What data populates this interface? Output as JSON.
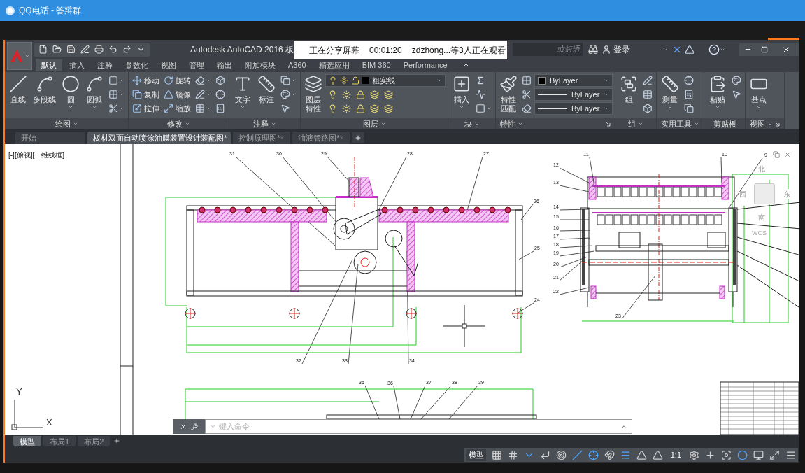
{
  "qq_window": {
    "title": "QQ电话 - 答辩群"
  },
  "share_banner": {
    "status": "正在分享屏幕",
    "timer": "00:01:20",
    "viewers": "zdzhong...等3人正在观看"
  },
  "titlebar": {
    "title": "Autodesk AutoCAD 2016",
    "title_cut": "板",
    "search_placeholder": "或短语",
    "login": "登录"
  },
  "ribbon_tabs": [
    {
      "label": "默认",
      "selected": true
    },
    {
      "label": "插入",
      "selected": false
    },
    {
      "label": "注释",
      "selected": false
    },
    {
      "label": "参数化",
      "selected": false
    },
    {
      "label": "视图",
      "selected": false
    },
    {
      "label": "管理",
      "selected": false
    },
    {
      "label": "输出",
      "selected": false
    },
    {
      "label": "附加模块",
      "selected": false
    },
    {
      "label": "A360",
      "selected": false
    },
    {
      "label": "精选应用",
      "selected": false
    },
    {
      "label": "BIM 360",
      "selected": false
    },
    {
      "label": "Performance",
      "selected": false
    }
  ],
  "ribbon_panels": [
    {
      "label": "绘图",
      "menu": true,
      "launcher": false,
      "columns": [
        [
          {
            "kind": "large",
            "label": "直线"
          }
        ],
        [
          {
            "kind": "large",
            "label": "多段线"
          }
        ],
        [
          {
            "kind": "large_menu",
            "label": "圆"
          }
        ],
        [
          {
            "kind": "large_menu",
            "label": "圆弧"
          }
        ],
        [
          {
            "kind": "icon_menu"
          },
          {
            "kind": "icon_menu"
          },
          {
            "kind": "icon_menu"
          }
        ]
      ]
    },
    {
      "label": "修改",
      "menu": true,
      "launcher": false,
      "columns": [
        [
          {
            "kind": "small",
            "label": "移动"
          },
          {
            "kind": "small",
            "label": "复制"
          },
          {
            "kind": "small",
            "label": "拉伸"
          }
        ],
        [
          {
            "kind": "small",
            "label": "旋转"
          },
          {
            "kind": "small",
            "label": "镜像"
          },
          {
            "kind": "small",
            "label": "缩放"
          }
        ],
        [
          {
            "kind": "icon_menu"
          },
          {
            "kind": "icon_menu"
          },
          {
            "kind": "icon_menu"
          }
        ],
        [
          {
            "kind": "icon"
          },
          {
            "kind": "icon"
          },
          {
            "kind": "icon"
          }
        ]
      ]
    },
    {
      "label": "注释",
      "menu": true,
      "launcher": false,
      "columns": [
        [
          {
            "kind": "large_menu",
            "label": "文字"
          }
        ],
        [
          {
            "kind": "large",
            "label": "标注"
          }
        ],
        [
          {
            "kind": "icon_menu"
          },
          {
            "kind": "icon_menu"
          },
          {
            "kind": "icon"
          }
        ]
      ]
    },
    {
      "label": "图层",
      "menu": true,
      "launcher": false,
      "columns": [
        [
          {
            "kind": "large_wrap",
            "label": "图层特性"
          }
        ],
        [
          {
            "kind": "dropdown",
            "value": "粗实线"
          },
          {
            "kind": "iconrow"
          },
          {
            "kind": "iconrow"
          }
        ]
      ]
    },
    {
      "label": "块",
      "menu": true,
      "launcher": false,
      "columns": [
        [
          {
            "kind": "large_menu",
            "label": "插入"
          }
        ],
        [
          {
            "kind": "icon"
          },
          {
            "kind": "icon"
          },
          {
            "kind": "icon_menu"
          }
        ]
      ]
    },
    {
      "label": "特性",
      "menu": true,
      "launcher": true,
      "columns": [
        [
          {
            "kind": "large_wrap",
            "label": "特性匹配"
          }
        ],
        [
          {
            "kind": "icon"
          },
          {
            "kind": "icon"
          },
          {
            "kind": "icon"
          }
        ],
        [
          {
            "kind": "swatch_dropdown",
            "value": "ByLayer"
          },
          {
            "kind": "line_dropdown",
            "value": "ByLayer"
          },
          {
            "kind": "line_dropdown",
            "value": "ByLayer"
          }
        ]
      ]
    },
    {
      "label": "组",
      "menu": true,
      "launcher": false,
      "columns": [
        [
          {
            "kind": "large",
            "label": "组"
          }
        ],
        [
          {
            "kind": "icon"
          },
          {
            "kind": "icon"
          },
          {
            "kind": "icon"
          }
        ]
      ]
    },
    {
      "label": "实用工具",
      "menu": true,
      "launcher": false,
      "columns": [
        [
          {
            "kind": "large_menu",
            "label": "测量"
          }
        ],
        [
          {
            "kind": "icon"
          },
          {
            "kind": "icon"
          },
          {
            "kind": "icon"
          }
        ]
      ]
    },
    {
      "label": "剪贴板",
      "menu": false,
      "launcher": false,
      "columns": [
        [
          {
            "kind": "large_menu",
            "label": "粘贴"
          }
        ],
        [
          {
            "kind": "icon"
          },
          {
            "kind": "icon"
          }
        ]
      ]
    },
    {
      "label": "视图",
      "menu": true,
      "launcher": true,
      "columns": [
        [
          {
            "kind": "large_menu",
            "label": "基点"
          }
        ]
      ]
    }
  ],
  "file_tabs": [
    {
      "label": "开始",
      "selected": false
    },
    {
      "label": "板材双面自动喷涂油膜装置设计装配图*",
      "selected": true
    },
    {
      "label": "控制原理图*",
      "selected": false
    },
    {
      "label": "油液管路图*",
      "selected": false
    }
  ],
  "canvas": {
    "viewport_label": "[-][俯视][二维线框]",
    "ucs_x": "X",
    "ucs_y": "Y",
    "balloons": [
      "31",
      "30",
      "29",
      "28",
      "27",
      "26",
      "25",
      "24",
      "32",
      "33",
      "34",
      "11",
      "10",
      "9",
      "12",
      "13",
      "14",
      "15",
      "16",
      "17",
      "18",
      "19",
      "20",
      "21",
      "22",
      "23",
      "35",
      "36",
      "37",
      "38",
      "39"
    ],
    "viewcube": {
      "north": "北",
      "west": "西",
      "south": "南",
      "east": "东",
      "wcs": "WCS"
    }
  },
  "command_line": {
    "placeholder": "键入命令"
  },
  "layout_tabs": [
    {
      "label": "模型",
      "selected": true
    },
    {
      "label": "布局1",
      "selected": false
    },
    {
      "label": "布局2",
      "selected": false
    }
  ],
  "status_bar": {
    "model": "模型",
    "scale": "1:1",
    "toggles_left": [
      {
        "on": false
      },
      {
        "on": false
      },
      {
        "on": true
      },
      {
        "on": false
      },
      {
        "on": false
      },
      {
        "on": true
      },
      {
        "on": true
      },
      {
        "on": false
      },
      {
        "on": true
      },
      {
        "on": false
      },
      {
        "on": false
      }
    ],
    "toggles_right": [
      {
        "on": false
      },
      {
        "on": false
      },
      {
        "on": false
      },
      {
        "on": true
      },
      {
        "on": false
      },
      {
        "on": false
      },
      {
        "on": false
      }
    ]
  }
}
